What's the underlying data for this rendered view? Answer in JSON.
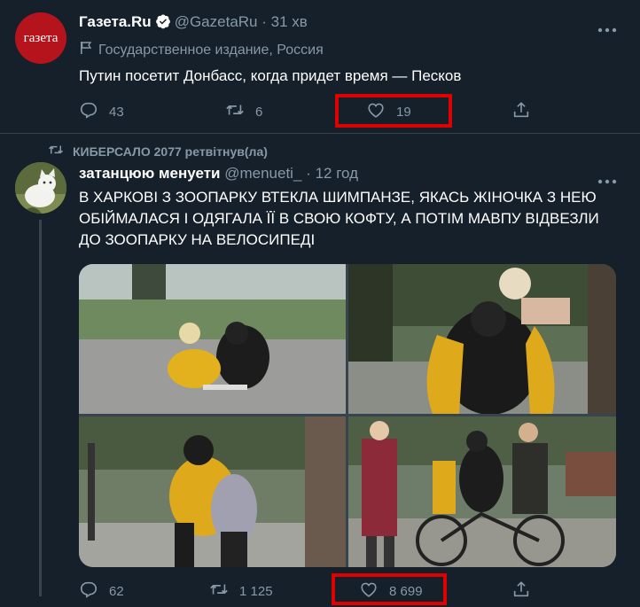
{
  "tweet1": {
    "avatar_text": "газета",
    "name": "Газета.Ru",
    "handle": "@GazetaRu",
    "separator": "·",
    "time": "31 хв",
    "label": "Государственное издание, Россия",
    "text": "Путин посетит Донбасс, когда придет время — Песков",
    "replies": "43",
    "retweets": "6",
    "likes": "19"
  },
  "tweet2": {
    "retweeted_by": "КИБЕРСАЛО 2077 ретвітнув(ла)",
    "name": "затанцюю менуети",
    "handle": "@menueti_",
    "separator": "·",
    "time": "12 год",
    "text": "В ХАРКОВІ З ЗООПАРКУ ВТЕКЛА ШИМПАНЗЕ, ЯКАСЬ ЖІНОЧКА З НЕЮ ОБІЙМАЛАСЯ І ОДЯГАЛА ЇЇ В СВОЮ КОФТУ, А ПОТІМ МАВПУ ВІДВЕЗЛИ ДО ЗООПАРКУ НА ВЕЛОСИПЕДІ",
    "replies": "62",
    "retweets": "1 125",
    "likes": "8 699",
    "photos": [
      "photo-1",
      "photo-2",
      "photo-3",
      "photo-4"
    ]
  },
  "colors": {
    "background": "#15202b",
    "border": "#38444d",
    "text_secondary": "#8899a6",
    "verified": "#1da1f2",
    "gazeta_red": "#b5141c",
    "highlight": "#e00000"
  },
  "icons": [
    "verified-icon",
    "more-icon",
    "government-flag-icon",
    "reply-icon",
    "retweet-icon",
    "like-icon",
    "share-icon"
  ]
}
